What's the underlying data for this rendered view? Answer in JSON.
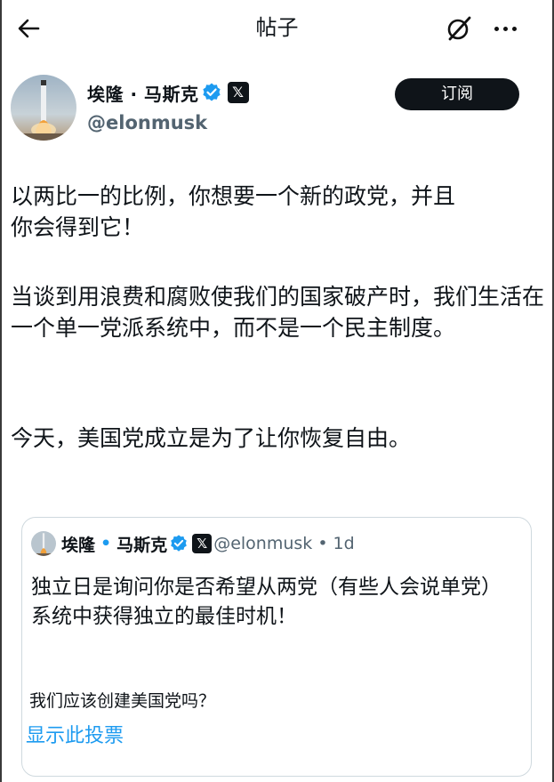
{
  "header": {
    "title": "帖子"
  },
  "author": {
    "name": "埃隆 · 马斯克",
    "handle": "@elonmusk",
    "x_badge": "𝕏",
    "subscribe_label": "订阅"
  },
  "post": {
    "paragraphs": [
      "以两比一的比例，你想要一个新的政党，并且你会得到它！",
      "当谈到用浪费和腐败使我们的国家破产时，我们生活在一个单一党派系统中，而不是一个民主制度。",
      "今天，美国党成立是为了让你恢复自由。"
    ]
  },
  "quote": {
    "name_first": "埃隆",
    "name_sep": "•",
    "name_last": "马斯克",
    "x_badge": "𝕏",
    "handle_time": "@elonmusk • 1d",
    "text": "独立日是询问你是否希望从两党（有些人会说单党）系统中获得独立的最佳时机！",
    "poll_question": "我们应该创建美国党吗？",
    "poll_link": "显示此投票"
  },
  "colors": {
    "accent": "#1d9bf0",
    "text": "#0f1419",
    "secondary": "#536471"
  },
  "icons": [
    "back-arrow-icon",
    "grok-icon",
    "more-icon",
    "verified-icon",
    "x-logo-icon"
  ]
}
